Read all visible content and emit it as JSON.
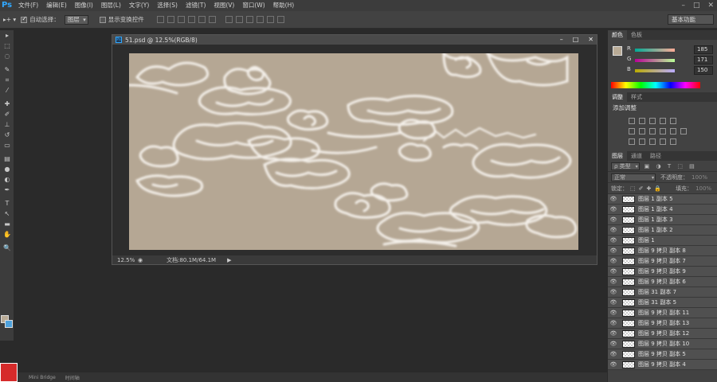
{
  "app": {
    "logo": "Ps"
  },
  "menu": [
    "文件(F)",
    "编辑(E)",
    "图像(I)",
    "图层(L)",
    "文字(Y)",
    "选择(S)",
    "滤镜(T)",
    "视图(V)",
    "窗口(W)",
    "帮助(H)"
  ],
  "window_controls": {
    "minimize": "–",
    "maximize": "□",
    "close": "✕"
  },
  "options_bar": {
    "auto_select_label": "自动选择：",
    "auto_select_value": "图层",
    "show_transform_label": "显示变换控件",
    "auto_select_checked": true
  },
  "workspace": {
    "label": "基本功能"
  },
  "toolbar": {
    "tools": [
      {
        "name": "move-tool-icon",
        "glyph": "▸"
      },
      {
        "name": "marquee-tool-icon",
        "glyph": "⬚"
      },
      {
        "name": "lasso-tool-icon",
        "glyph": "◌"
      },
      {
        "name": "quick-select-tool-icon",
        "glyph": "✎"
      },
      {
        "name": "crop-tool-icon",
        "glyph": "⌗"
      },
      {
        "name": "eyedropper-tool-icon",
        "glyph": "⁄"
      },
      {
        "name": "healing-tool-icon",
        "glyph": "✚"
      },
      {
        "name": "brush-tool-icon",
        "glyph": "✐"
      },
      {
        "name": "stamp-tool-icon",
        "glyph": "⊥"
      },
      {
        "name": "history-brush-tool-icon",
        "glyph": "↺"
      },
      {
        "name": "eraser-tool-icon",
        "glyph": "▭"
      },
      {
        "name": "gradient-tool-icon",
        "glyph": "▤"
      },
      {
        "name": "blur-tool-icon",
        "glyph": "●"
      },
      {
        "name": "dodge-tool-icon",
        "glyph": "◐"
      },
      {
        "name": "pen-tool-icon",
        "glyph": "✒"
      },
      {
        "name": "type-tool-icon",
        "glyph": "T"
      },
      {
        "name": "path-select-tool-icon",
        "glyph": "↖"
      },
      {
        "name": "shape-tool-icon",
        "glyph": "▬"
      },
      {
        "name": "hand-tool-icon",
        "glyph": "✋"
      },
      {
        "name": "zoom-tool-icon",
        "glyph": "🔍"
      }
    ]
  },
  "document": {
    "title": "51.psd @ 12.5%(RGB/8)",
    "icon_label": "Ps",
    "zoom": "12.5%",
    "doc_info": "文档:80.1M/64.1M",
    "canvas_color": "#b5a794"
  },
  "color_panel": {
    "tabs": [
      "颜色",
      "色板"
    ],
    "r": {
      "label": "R",
      "value": "185"
    },
    "g": {
      "label": "G",
      "value": "171"
    },
    "b": {
      "label": "B",
      "value": "150"
    },
    "fg_color": "#b9ab96"
  },
  "adjustments_panel": {
    "tabs": [
      "调整",
      "样式"
    ],
    "title": "添加调整"
  },
  "layers_panel": {
    "tabs": [
      "图层",
      "通道",
      "路径"
    ],
    "filter_label": "ρ 类型",
    "blend_mode": "正常",
    "opacity_label": "不透明度：",
    "opacity_value": "100%",
    "lock_label": "锁定：",
    "fill_label": "填充：",
    "fill_value": "100%",
    "layers": [
      "图层 1 副本 5",
      "图层 1 副本 4",
      "图层 1 副本 3",
      "图层 1 副本 2",
      "图层 1",
      "图层 9 拷贝 副本 8",
      "图层 9 拷贝 副本 7",
      "图层 9 拷贝 副本 9",
      "图层 9 拷贝 副本 6",
      "图层 31 副本 7",
      "图层 31 副本 5",
      "图层 9 拷贝 副本 11",
      "图层 9 拷贝 副本 13",
      "图层 9 拷贝 副本 12",
      "图层 9 拷贝 副本 10",
      "图层 9 拷贝 副本 5",
      "图层 9 拷贝 副本 4"
    ]
  },
  "taskbar": {
    "tabs": [
      "Mini Bridge",
      "时间轴"
    ]
  }
}
